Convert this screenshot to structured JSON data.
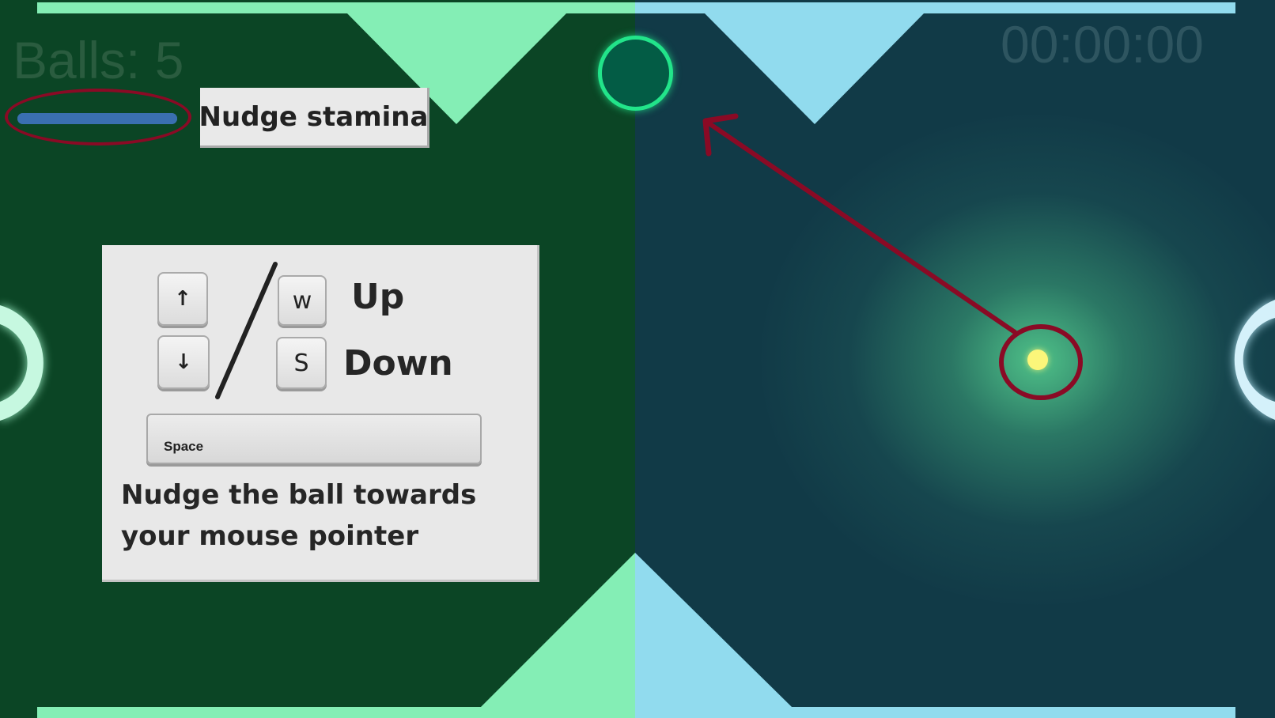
{
  "hud": {
    "balls_label": "Balls: 5",
    "timer": "00:00:00"
  },
  "stamina": {
    "label": "Nudge stamina",
    "level_percent": 100,
    "bar_color": "#3a6fb0"
  },
  "controls_help": {
    "keys": {
      "up_arrow": "↑",
      "down_arrow": "↓",
      "w": "w",
      "s": "S",
      "space": "Space"
    },
    "up_label": "Up",
    "down_label": "Down",
    "description": "Nudge the ball towards your mouse pointer"
  },
  "colors": {
    "left_field": "#0b4525",
    "right_field": "#113a47",
    "left_accent": "#84eeb5",
    "right_accent": "#91dbee",
    "annotation": "#8a0a25",
    "ball": "#fbf67a",
    "goal_puck": "#035c45",
    "goal_puck_ring": "#22e48a"
  },
  "icons": [
    "arrow-up-icon",
    "arrow-down-icon",
    "direction-arrow-annotation",
    "goal-left-arc",
    "goal-right-arc"
  ]
}
